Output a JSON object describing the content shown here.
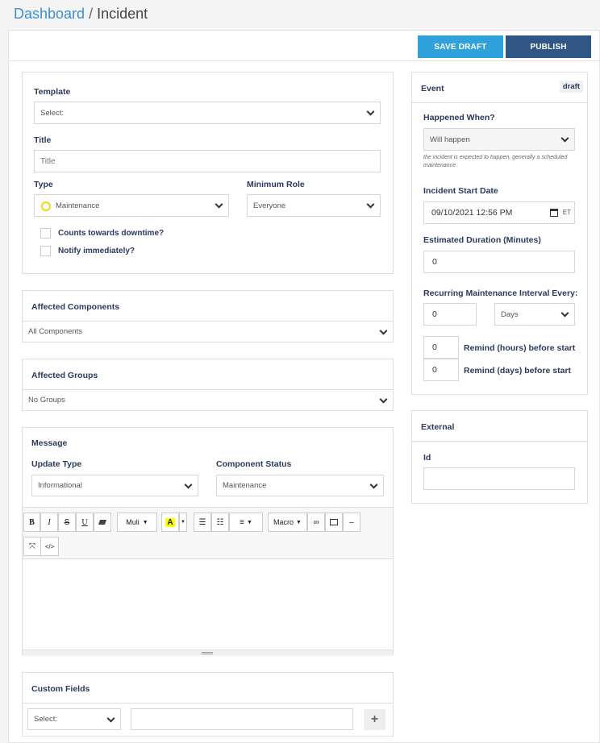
{
  "breadcrumb": {
    "home": "Dashboard",
    "separator": "/",
    "current": "Incident"
  },
  "toolbar": {
    "save_draft": "SAVE DRAFT",
    "publish": "PUBLISH"
  },
  "incident": {
    "template_label": "Template",
    "template_value": "Select:",
    "title_label": "Title",
    "title_placeholder": "Title",
    "type_label": "Type",
    "type_value": "Maintenance",
    "role_label": "Minimum Role",
    "role_value": "Everyone",
    "counts_label": "Counts towards downtime?",
    "notify_label": "Notify immediately?"
  },
  "affected_components": {
    "title": "Affected Components",
    "value": "All Components"
  },
  "affected_groups": {
    "title": "Affected Groups",
    "value": "No Groups"
  },
  "message": {
    "title": "Message",
    "update_type_label": "Update Type",
    "update_type_value": "Informational",
    "component_status_label": "Component Status",
    "component_status_value": "Maintenance"
  },
  "editor": {
    "bold": "B",
    "italic": "I",
    "strike": "S",
    "underline": "U",
    "font": "Muli",
    "macro": "Macro"
  },
  "custom_fields": {
    "title": "Custom Fields",
    "select": "Select:"
  },
  "event": {
    "title": "Event",
    "badge": "draft",
    "happened_label": "Happened When?",
    "happened_value": "Will happen",
    "happened_hint": "the incident is expected to happen, generally a scheduled maintenance",
    "start_label": "Incident Start Date",
    "start_value": "09/10/2021 12:56 PM",
    "tz": "ET",
    "duration_label": "Estimated Duration (Minutes)",
    "duration_value": "0",
    "recurring_label": "Recurring Maintenance Interval Every:",
    "recurring_value": "0",
    "recurring_unit": "Days",
    "remind_hours_value": "0",
    "remind_hours_label": "Remind (hours) before start",
    "remind_days_value": "0",
    "remind_days_label": "Remind (days) before start"
  },
  "external": {
    "title": "External",
    "id_label": "Id"
  },
  "colors": {
    "link": "#3b8fd3",
    "save_draft": "#2fa2dc",
    "publish": "#2f5685",
    "status_yellow": "#f5d40f"
  }
}
